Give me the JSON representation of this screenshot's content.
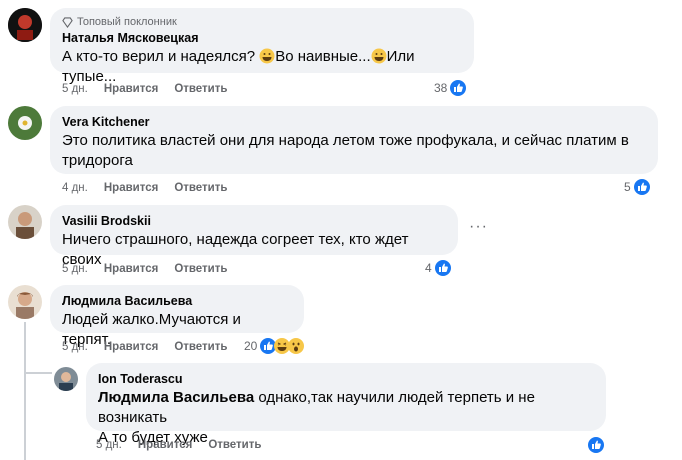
{
  "comments": [
    {
      "badge": "Топовый поклонник",
      "author": "Наталья Мясковецкая",
      "text_parts": [
        "А кто-то верил и надеялся? ",
        "Во наивные...",
        "Или тупые..."
      ],
      "time": "5 дн.",
      "like_label": "Нравится",
      "reply_label": "Ответить",
      "reactions": "38"
    },
    {
      "author": "Vera Kitchener",
      "text": "Это политика властей они для народа летом тоже профукала, и сейчас платим в тридорога",
      "time": "4 дн.",
      "like_label": "Нравится",
      "reply_label": "Ответить",
      "reactions": "5"
    },
    {
      "author": "Vasilii Brodskii",
      "text": "Ничего страшного, надежда согреет тех, кто ждет своих",
      "time": "5 дн.",
      "like_label": "Нравится",
      "reply_label": "Ответить",
      "reactions": "4"
    },
    {
      "author": "Людмила Васильева",
      "text": "Людей жалко.Мучаются и терпят.",
      "time": "5 дн.",
      "like_label": "Нравится",
      "reply_label": "Ответить",
      "reactions": "20"
    }
  ],
  "reply": {
    "author": "Ion Toderascu",
    "mention": "Людмила Васильева",
    "text_line1": " однако,так научили людей терпеть и не возникать",
    "text_line2": "А то будет хуже",
    "time": "5 дн.",
    "like_label": "Нравится",
    "reply_label": "Ответить"
  },
  "colors": {
    "like_blue": "#1877f2",
    "bubble": "#f0f2f5",
    "secondary_text": "#65676b"
  },
  "icons": [
    "diamond-icon",
    "like-icon",
    "haha-emoji-icon",
    "wow-emoji-icon",
    "more-options-icon"
  ]
}
